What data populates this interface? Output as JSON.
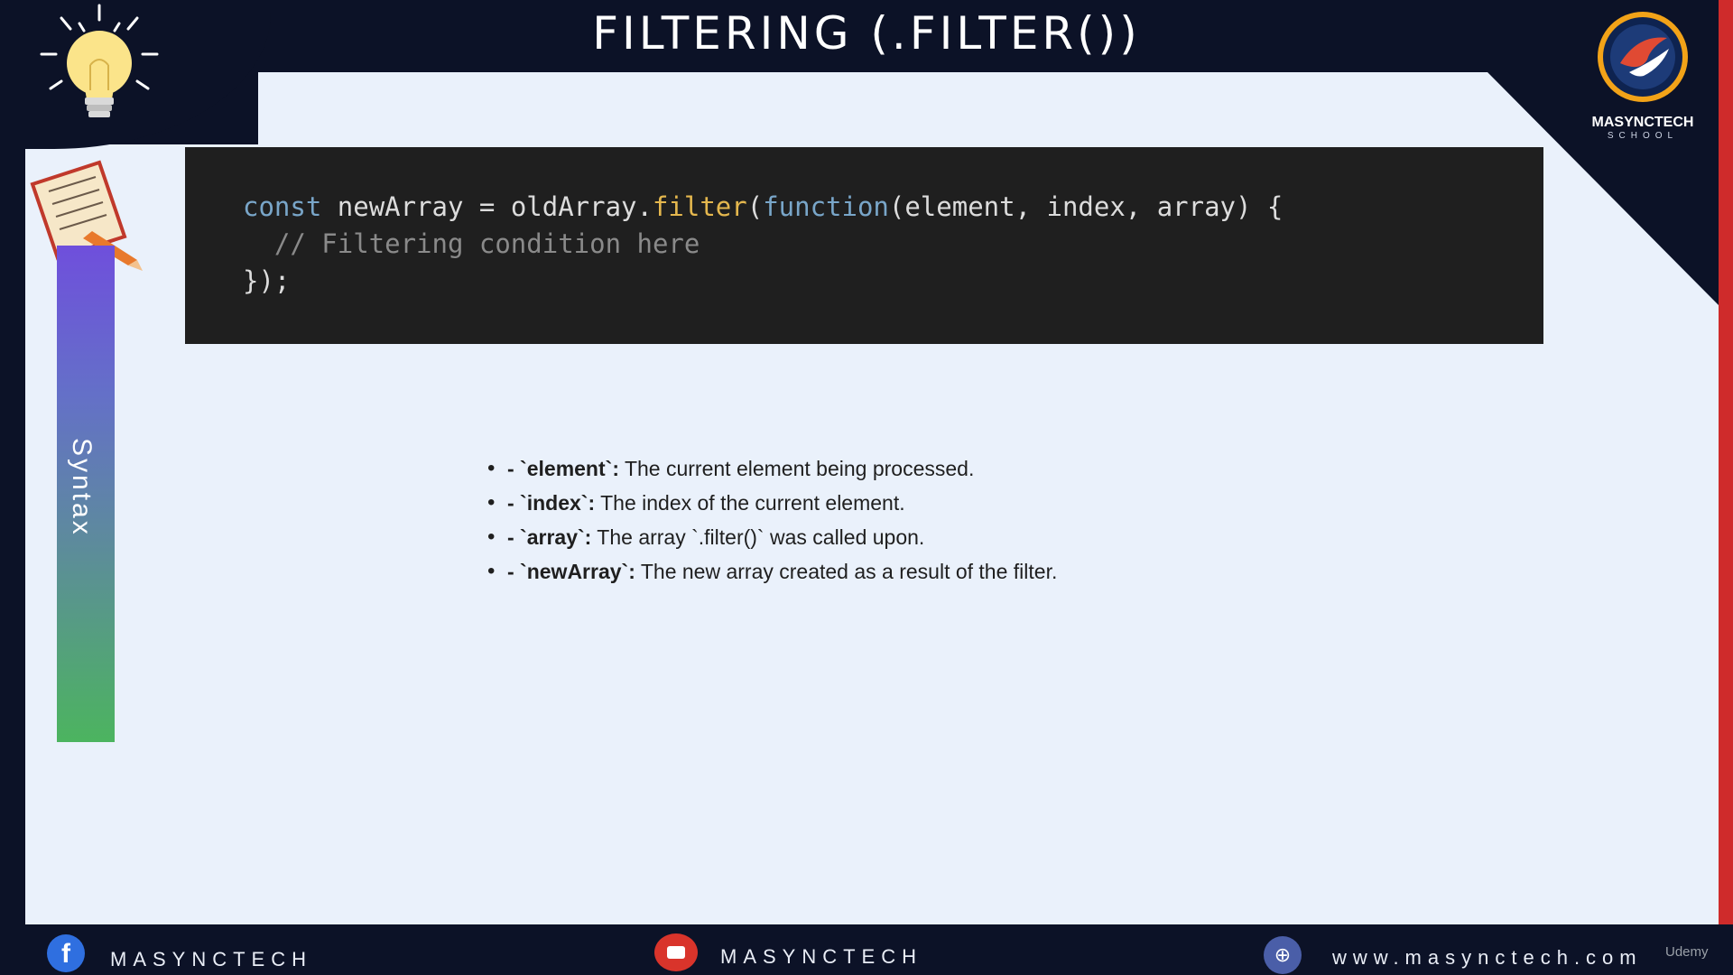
{
  "slide": {
    "title": "FILTERING (.FILTER())",
    "side_label": "Syntax"
  },
  "code": {
    "line1": {
      "kw1": "const",
      "part1": " newArray = oldArray.",
      "fn": "filter",
      "part2": "(",
      "kw2": "function",
      "part3": "(element, index, array) {"
    },
    "line2": "  // Filtering condition here",
    "line3": "});"
  },
  "bullets": [
    {
      "prefix": "- `",
      "term": "element",
      "suffix": "`:",
      "desc": " The current element being processed."
    },
    {
      "prefix": "- `",
      "term": "index",
      "suffix": "`:",
      "desc": " The index of the current element."
    },
    {
      "prefix": "- `",
      "term": "array",
      "suffix": "`:",
      "desc": " The array `.filter()` was called upon."
    },
    {
      "prefix": "- `",
      "term": "newArray",
      "suffix": "`:",
      "desc": " The new array created as a result of the filter."
    }
  ],
  "logo": {
    "name": "MASYNCTECH",
    "sub": "SCHOOL"
  },
  "footer": {
    "facebook_handle": "MASYNCTECH",
    "youtube_handle": "MASYNCTECH",
    "website": "www.masynctech.com",
    "watermark": "Udemy"
  },
  "icons": {
    "facebook": "facebook-icon",
    "youtube": "youtube-icon",
    "web": "globe-icon",
    "bulb": "lightbulb-icon",
    "notebook": "notebook-pencil-icon"
  },
  "colors": {
    "background": "#0c1227",
    "panel": "#eaf1fb",
    "code_bg": "#1f1f1f",
    "keyword": "#79a6c9",
    "function": "#e4b74e",
    "comment": "#8a8a8a",
    "accent_red": "#cf2b2b"
  }
}
